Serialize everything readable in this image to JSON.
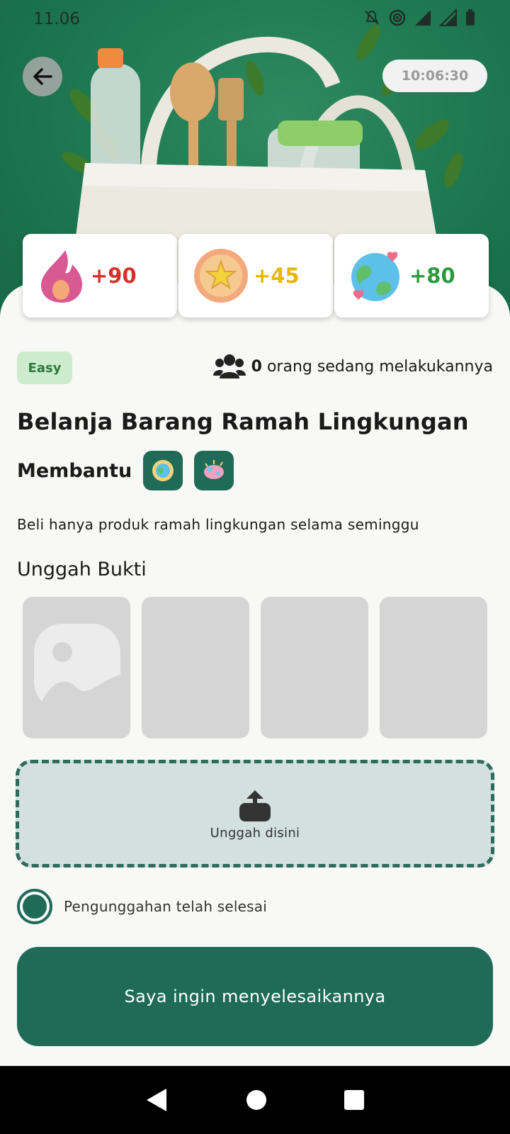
{
  "status_bar": {
    "time": "11.06"
  },
  "header": {
    "timer": "10:06:30"
  },
  "rewards": [
    {
      "icon": "flame-icon",
      "value": "+90",
      "color": "#d3322c"
    },
    {
      "icon": "coin-icon",
      "value": "+45",
      "color": "#e6b800"
    },
    {
      "icon": "earth-icon",
      "value": "+80",
      "color": "#2e9a3e"
    }
  ],
  "challenge": {
    "difficulty": "Easy",
    "participants_count": "0",
    "participants_text": "orang sedang melakukannya",
    "title": "Belanja Barang Ramah Lingkungan",
    "helps_label": "Membantu",
    "description": "Beli hanya produk ramah lingkungan selama seminggu"
  },
  "upload": {
    "section_title": "Unggah Bukti",
    "dropzone_label": "Unggah disini",
    "completed_label": "Pengunggahan telah selesai"
  },
  "cta": {
    "label": "Saya ingin menyelesaikannya"
  },
  "colors": {
    "primary": "#1f6b58",
    "hero_bg": "#1f7a52",
    "easy_badge_bg": "#cdeccd"
  }
}
